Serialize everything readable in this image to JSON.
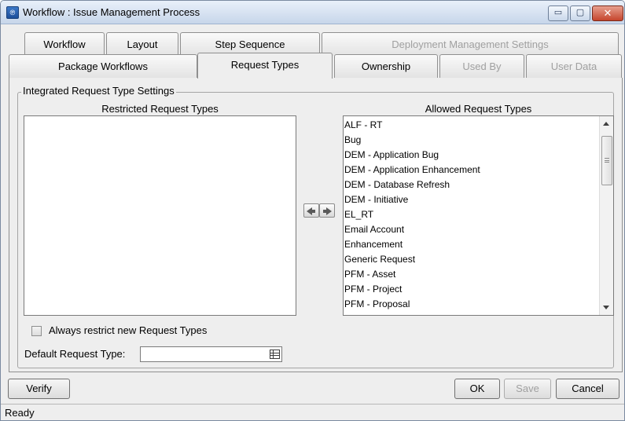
{
  "window": {
    "title": "Workflow : Issue Management Process",
    "app_icon": "app-logo-icon",
    "controls": {
      "minimize": "▭",
      "maximize": "▢",
      "close": "✕"
    }
  },
  "tabs": {
    "row1": [
      {
        "label": "Workflow",
        "state": "normal"
      },
      {
        "label": "Layout",
        "state": "normal"
      },
      {
        "label": "Step Sequence",
        "state": "normal"
      },
      {
        "label": "Deployment Management Settings",
        "state": "disabled"
      }
    ],
    "row2": [
      {
        "label": "Package Workflows",
        "state": "normal"
      },
      {
        "label": "Request Types",
        "state": "active"
      },
      {
        "label": "Ownership",
        "state": "normal"
      },
      {
        "label": "Used By",
        "state": "disabled"
      },
      {
        "label": "User Data",
        "state": "disabled"
      }
    ]
  },
  "settings": {
    "group_title": "Integrated Request Type Settings",
    "restricted": {
      "header": "Restricted Request Types",
      "items": []
    },
    "allowed": {
      "header": "Allowed Request Types",
      "items": [
        "ALF - RT",
        "Bug",
        "DEM - Application Bug",
        "DEM - Application Enhancement",
        "DEM - Database Refresh",
        "DEM - Initiative",
        "EL_RT",
        "Email Account",
        "Enhancement",
        "Generic Request",
        "PFM - Asset",
        "PFM - Project",
        "PFM - Proposal"
      ]
    },
    "always_restrict": {
      "label": "Always restrict new Request Types",
      "checked": false
    },
    "default_type": {
      "label": "Default Request Type:",
      "value": ""
    }
  },
  "buttons": {
    "verify": "Verify",
    "ok": "OK",
    "save": "Save",
    "cancel": "Cancel"
  },
  "status": {
    "text": "Ready"
  }
}
